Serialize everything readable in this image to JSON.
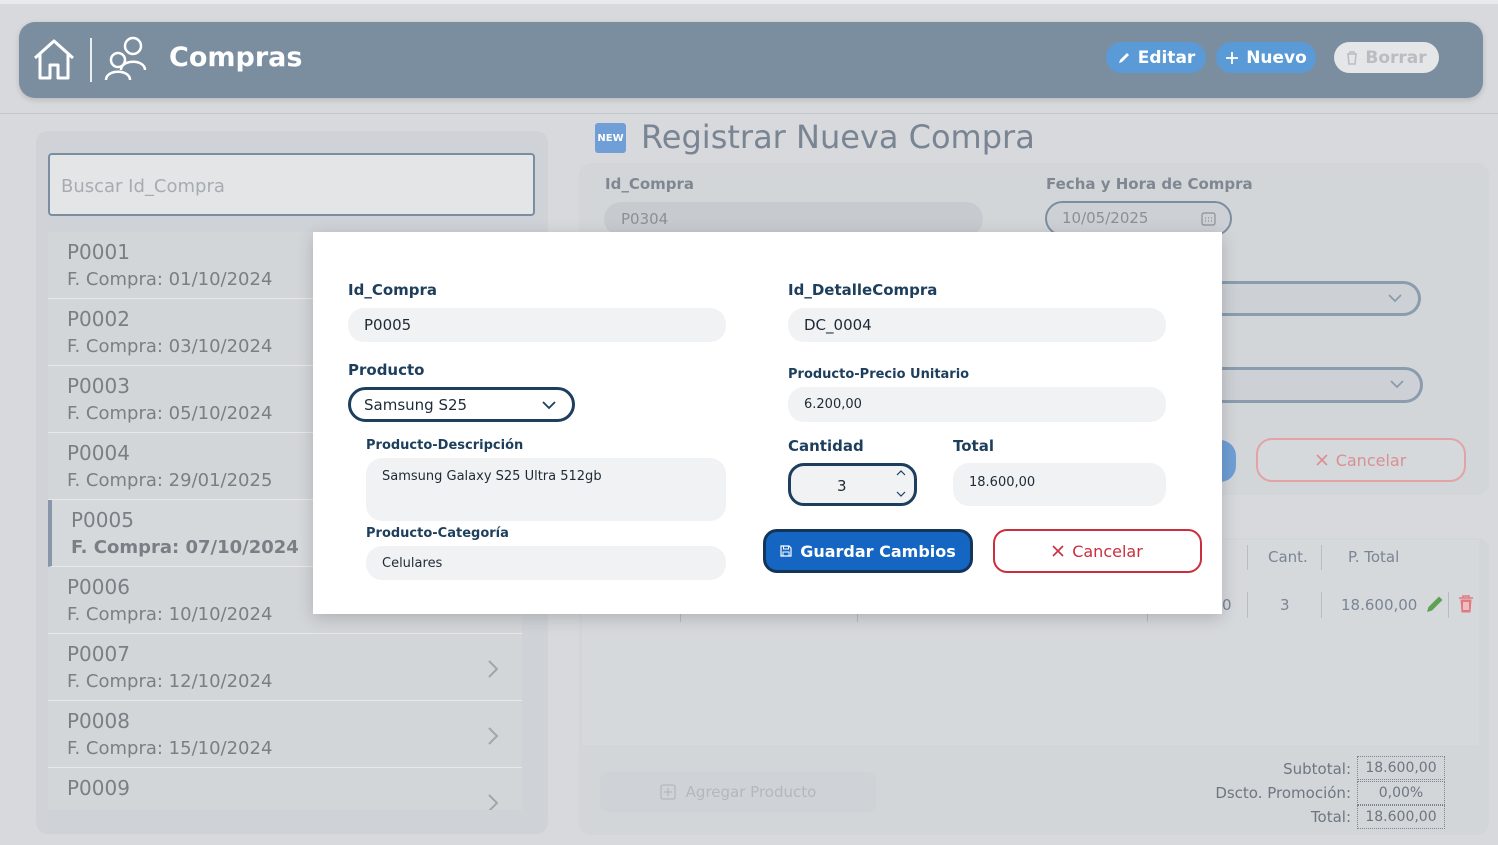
{
  "header": {
    "title": "Compras",
    "edit_label": "Editar",
    "new_label": "Nuevo",
    "delete_label": "Borrar"
  },
  "sidebar": {
    "search_placeholder": "Buscar Id_Compra",
    "items": [
      {
        "id": "P0001",
        "date": "F. Compra: 01/10/2024"
      },
      {
        "id": "P0002",
        "date": "F. Compra: 03/10/2024"
      },
      {
        "id": "P0003",
        "date": "F. Compra: 05/10/2024"
      },
      {
        "id": "P0004",
        "date": "F. Compra: 29/01/2025"
      },
      {
        "id": "P0005",
        "date": "F. Compra: 07/10/2024",
        "selected": true
      },
      {
        "id": "P0006",
        "date": "F. Compra: 10/10/2024"
      },
      {
        "id": "P0007",
        "date": "F. Compra: 12/10/2024"
      },
      {
        "id": "P0008",
        "date": "F. Compra: 15/10/2024"
      },
      {
        "id": "P0009",
        "date": ""
      }
    ]
  },
  "form": {
    "icon_text": "NEW",
    "title": "Registrar Nueva Compra",
    "id_label": "Id_Compra",
    "id_value": "P0304",
    "date_label": "Fecha y Hora de Compra",
    "date_value": "10/05/2025",
    "cancel_label": "Cancelar"
  },
  "table": {
    "headers": {
      "cant": "Cant.",
      "ptotal": "P. Total"
    },
    "row": {
      "partial": "0",
      "cant": "3",
      "ptotal": "18.600,00"
    },
    "add_product_label": "Agregar Producto",
    "subtotal_label": "Subtotal:",
    "subtotal_value": "18.600,00",
    "discount_label": "Dscto. Promoción:",
    "discount_value": "0,00%",
    "total_label": "Total:",
    "total_value": "18.600,00"
  },
  "modal": {
    "id_compra_label": "Id_Compra",
    "id_compra_value": "P0005",
    "id_detalle_label": "Id_DetalleCompra",
    "id_detalle_value": "DC_0004",
    "producto_label": "Producto",
    "producto_value": "Samsung S25",
    "precio_label": "Producto-Precio Unitario",
    "precio_value": "6.200,00",
    "descripcion_label": "Producto-Descripción",
    "descripcion_value": "Samsung Galaxy S25 Ultra 512gb",
    "cantidad_label": "Cantidad",
    "cantidad_value": "3",
    "total_label": "Total",
    "total_value": "18.600,00",
    "categoria_label": "Producto-Categoría",
    "categoria_value": "Celulares",
    "save_label": "Guardar Cambios",
    "cancel_label": "Cancelar"
  },
  "colors": {
    "header_bg": "#7b8ea0",
    "primary": "#1466c2",
    "danger": "#c92f3c",
    "label_dark": "#1d3e5c"
  },
  "icons": [
    "home-icon",
    "users-icon",
    "pencil-icon",
    "plus-icon",
    "trash-icon",
    "calendar-icon",
    "chevron-down-icon",
    "chevron-right-icon",
    "save-icon",
    "close-icon",
    "add-box-icon",
    "new-badge-icon"
  ]
}
